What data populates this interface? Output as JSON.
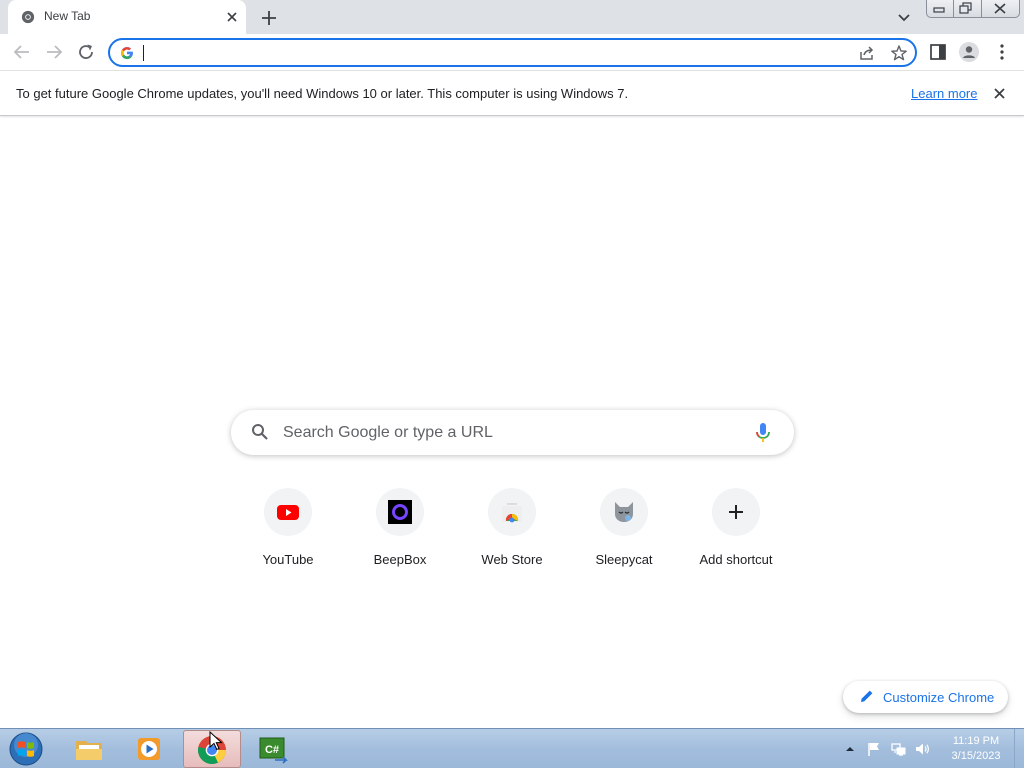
{
  "window": {
    "tab_title": "New Tab",
    "icons": {
      "favicon": "chrome-icon",
      "close": "close-icon",
      "new_tab": "plus-icon",
      "tab_search": "chevron-down-icon",
      "minimize": "minimize-icon",
      "restore": "restore-icon",
      "close_window": "close-icon"
    }
  },
  "toolbar": {
    "address_value": "",
    "icons": [
      "back-icon",
      "forward-icon",
      "reload-icon",
      "google-g-icon",
      "share-icon",
      "star-icon",
      "side-panel-icon",
      "profile-icon",
      "menu-icon"
    ]
  },
  "infobar": {
    "message": "To get future Google Chrome updates, you'll need Windows 10 or later. This computer is using Windows 7.",
    "link": "Learn more"
  },
  "ntp": {
    "search_placeholder": "Search Google or type a URL",
    "shortcuts": [
      {
        "label": "YouTube",
        "icon": "youtube-icon"
      },
      {
        "label": "BeepBox",
        "icon": "beepbox-icon"
      },
      {
        "label": "Web Store",
        "icon": "web-store-icon"
      },
      {
        "label": "Sleepycat",
        "icon": "sleepycat-icon"
      },
      {
        "label": "Add shortcut",
        "icon": "plus-icon"
      }
    ],
    "customize_label": "Customize Chrome"
  },
  "taskbar": {
    "items": [
      "windows-start-icon",
      "file-explorer-icon",
      "media-player-icon",
      "chrome-icon",
      "csharp-editor-icon"
    ],
    "active_item": "chrome-icon",
    "tray": [
      "show-hidden-icons-icon",
      "flag-icon",
      "network-icon",
      "volume-icon"
    ],
    "time": "11:19 PM",
    "date": "3/15/2023"
  },
  "colors": {
    "accent": "#1a73e8",
    "tabstrip": "#dee1e6",
    "taskbar": "#a3bedd",
    "youtube_red": "#ff0000",
    "beepbox_purple": "#7744ff"
  }
}
